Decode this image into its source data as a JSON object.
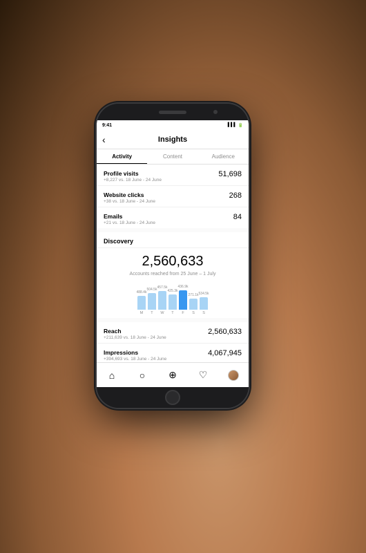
{
  "background": "#1a1a1a",
  "status_bar": {
    "time": "9:41",
    "icons": [
      "▌▌▌",
      "WiFi",
      "🔋"
    ]
  },
  "header": {
    "back_label": "‹",
    "title": "Insights"
  },
  "tabs": [
    {
      "label": "Activity",
      "active": true
    },
    {
      "label": "Content",
      "active": false
    },
    {
      "label": "Audience",
      "active": false
    }
  ],
  "metrics": [
    {
      "label": "Profile visits",
      "sub": "+8,227 vs. 18 June - 24 June",
      "value": "51,698"
    },
    {
      "label": "Website clicks",
      "sub": "+38 vs. 18 June - 24 June",
      "value": "268"
    },
    {
      "label": "Emails",
      "sub": "+21 vs. 18 June - 24 June",
      "value": "84"
    }
  ],
  "discovery": {
    "section_title": "Discovery",
    "big_number": "2,560,633",
    "description": "Accounts reached from\n25 June – 1 July",
    "chart": {
      "bars": [
        {
          "day": "M",
          "value": 68,
          "label": "488.4k",
          "highlight": false
        },
        {
          "day": "T",
          "value": 82,
          "label": "504.5k",
          "highlight": false
        },
        {
          "day": "W",
          "value": 90,
          "label": "457.5k",
          "highlight": false
        },
        {
          "day": "T",
          "value": 75,
          "label": "425.3k",
          "highlight": false
        },
        {
          "day": "F",
          "value": 95,
          "label": "436.9k",
          "highlight": true
        },
        {
          "day": "S",
          "value": 55,
          "label": "271.1k",
          "highlight": false
        },
        {
          "day": "S",
          "value": 60,
          "label": "534.5k",
          "highlight": false
        }
      ]
    }
  },
  "reach_metrics": [
    {
      "label": "Reach",
      "sub": "+211,639 vs. 18 June - 24 June",
      "value": "2,560,633"
    },
    {
      "label": "Impressions",
      "sub": "+394,693 vs. 18 June - 24 June",
      "value": "4,067,945"
    }
  ],
  "bottom_nav": {
    "icons": [
      "⌂",
      "○",
      "⊕",
      "♡",
      "●"
    ]
  }
}
